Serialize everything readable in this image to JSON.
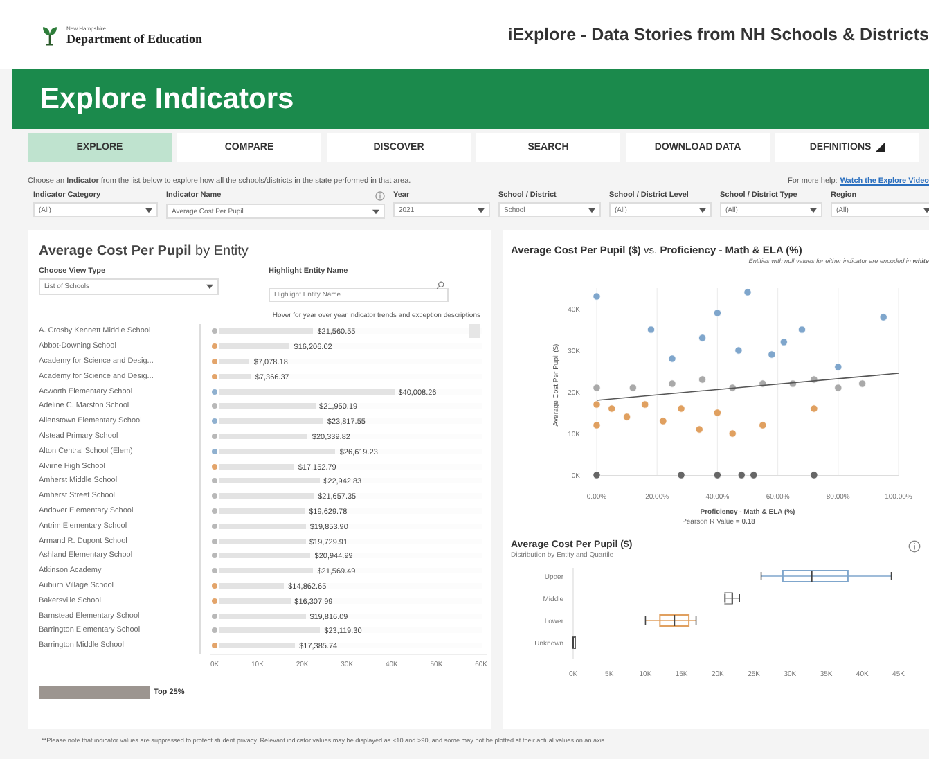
{
  "header": {
    "org_small": "New Hampshire",
    "org_name": "Department of Education",
    "site_title": "iExplore - Data Stories from NH Schools & Districts"
  },
  "banner": {
    "title": "Explore Indicators"
  },
  "tabs": [
    {
      "label": "EXPLORE",
      "selected": true
    },
    {
      "label": "COMPARE",
      "selected": false
    },
    {
      "label": "DISCOVER",
      "selected": false
    },
    {
      "label": "SEARCH",
      "selected": false
    },
    {
      "label": "DOWNLOAD DATA",
      "selected": false
    },
    {
      "label": "DEFINITIONS",
      "selected": false,
      "kind": "menu"
    }
  ],
  "instructions": {
    "text": "Choose an **Indicator** from the list below to explore how all the schools/districts in the state performed in that area.",
    "help_label": "For more help:",
    "help_link": "Watch the Explore Video"
  },
  "filters": [
    {
      "label": "Indicator Category",
      "value": "(All)"
    },
    {
      "label": "Indicator Name",
      "value": "Average Cost Per Pupil",
      "info": true
    },
    {
      "label": "Year",
      "value": "2021"
    },
    {
      "label": "School / District",
      "value": "School"
    },
    {
      "label": "School / District Level",
      "value": "(All)"
    },
    {
      "label": "School / District Type",
      "value": "(All)"
    },
    {
      "label": "Region",
      "value": "(All)"
    }
  ],
  "entity_panel": {
    "title": "**Average Cost Per Pupil** by Entity",
    "view_type_label": "Choose View Type",
    "view_type_value": "List of Schools",
    "highlight_label": "Highlight Entity Name",
    "highlight_placeholder": "Highlight Entity Name",
    "hint": "Hover for year over year indicator trends and exception descriptions",
    "entities": [
      {
        "name": "A. Crosby Kennett Middle School",
        "value": "$21,560.55",
        "level": 0.359,
        "color": "#b8b8b8"
      },
      {
        "name": "Abbot-Downing School",
        "value": "$16,206.02",
        "level": 0.27,
        "color": "#e3a46a"
      },
      {
        "name": "Academy for Science and Desig...",
        "value": "$7,078.18",
        "level": 0.118,
        "color": "#e3a46a"
      },
      {
        "name": "Academy for Science and Desig...",
        "value": "$7,366.37",
        "level": 0.123,
        "color": "#e3a46a"
      },
      {
        "name": "Acworth Elementary School",
        "value": "$40,008.26",
        "level": 0.667,
        "color": "#8fb0cf"
      },
      {
        "name": "Adeline C. Marston School",
        "value": "$21,950.19",
        "level": 0.366,
        "color": "#b8b8b8"
      },
      {
        "name": "Allenstown Elementary School",
        "value": "$23,817.55",
        "level": 0.397,
        "color": "#8fb0cf"
      },
      {
        "name": "Alstead Primary School",
        "value": "$20,339.82",
        "level": 0.339,
        "color": "#b8b8b8"
      },
      {
        "name": "Alton Central School (Elem)",
        "value": "$26,619.23",
        "level": 0.444,
        "color": "#8fb0cf"
      },
      {
        "name": "Alvirne High School",
        "value": "$17,152.79",
        "level": 0.286,
        "color": "#e3a46a"
      },
      {
        "name": "Amherst Middle School",
        "value": "$22,942.83",
        "level": 0.382,
        "color": "#b8b8b8"
      },
      {
        "name": "Amherst Street School",
        "value": "$21,657.35",
        "level": 0.361,
        "color": "#b8b8b8"
      },
      {
        "name": "Andover Elementary School",
        "value": "$19,629.78",
        "level": 0.327,
        "color": "#b8b8b8"
      },
      {
        "name": "Antrim Elementary School",
        "value": "$19,853.90",
        "level": 0.331,
        "color": "#b8b8b8"
      },
      {
        "name": "Armand R. Dupont School",
        "value": "$19,729.91",
        "level": 0.329,
        "color": "#b8b8b8"
      },
      {
        "name": "Ashland Elementary School",
        "value": "$20,944.99",
        "level": 0.349,
        "color": "#b8b8b8"
      },
      {
        "name": "Atkinson Academy",
        "value": "$21,569.49",
        "level": 0.359,
        "color": "#b8b8b8"
      },
      {
        "name": "Auburn Village School",
        "value": "$14,862.65",
        "level": 0.248,
        "color": "#e3a46a"
      },
      {
        "name": "Bakersville School",
        "value": "$16,307.99",
        "level": 0.272,
        "color": "#e3a46a"
      },
      {
        "name": "Barnstead Elementary School",
        "value": "$19,816.09",
        "level": 0.33,
        "color": "#b8b8b8"
      },
      {
        "name": "Barrington Elementary School",
        "value": "$23,119.30",
        "level": 0.385,
        "color": "#b8b8b8"
      },
      {
        "name": "Barrington Middle School",
        "value": "$17,385.74",
        "level": 0.29,
        "color": "#e3a46a"
      }
    ],
    "axis_ticks": [
      "0K",
      "10K",
      "20K",
      "30K",
      "40K",
      "50K",
      "60K"
    ],
    "legend": {
      "label": "Top 25%"
    }
  },
  "scatter_panel": {
    "title": "**Average Cost Per Pupil ($)** vs. **Proficiency - Math & ELA (%)**",
    "subtitle": "Entities with null values for either indicator are encoded in **white**",
    "pearson": "Pearson R Value = **0.18**",
    "chart_data": {
      "type": "scatter",
      "xlabel": "Proficiency - Math & ELA (%)",
      "ylabel": "Average Cost Per Pupil ($)",
      "xlim": [
        0,
        100
      ],
      "ylim": [
        0,
        45
      ],
      "xticks": [
        {
          "value": 0,
          "label": "0.00%"
        },
        {
          "value": 20,
          "label": "20.00%"
        },
        {
          "value": 40,
          "label": "40.00%"
        },
        {
          "value": 60,
          "label": "60.00%"
        },
        {
          "value": 80,
          "label": "80.00%"
        },
        {
          "value": 100,
          "label": "100.00%"
        }
      ],
      "yticks": [
        {
          "value": 0,
          "label": "0K"
        },
        {
          "value": 10,
          "label": "10K"
        },
        {
          "value": 20,
          "label": "20K"
        },
        {
          "value": 30,
          "label": "30K"
        },
        {
          "value": 40,
          "label": "40K"
        }
      ],
      "grid": true,
      "x": [
        0,
        18,
        25,
        35,
        40,
        47,
        50,
        58,
        62,
        68,
        80,
        95,
        0,
        12,
        25,
        35,
        45,
        55,
        65,
        72,
        80,
        88,
        0,
        0,
        5,
        10,
        16,
        22,
        28,
        34,
        40,
        45,
        55,
        72,
        0,
        28,
        40,
        48,
        52,
        72,
        0,
        100
      ],
      "series": [
        {
          "color": "#7fa6cc",
          "values": [
            43,
            35,
            28,
            33,
            39,
            30,
            44,
            29,
            32,
            35,
            26,
            38,
            null,
            null,
            null,
            null,
            null,
            null,
            null,
            null,
            null,
            null,
            null,
            null,
            null,
            null,
            null,
            null,
            null,
            null,
            null,
            null,
            null,
            null,
            null,
            null,
            null,
            null,
            null,
            null,
            null,
            null
          ]
        },
        {
          "color": "#a9a9a9",
          "values": [
            null,
            null,
            null,
            null,
            null,
            null,
            null,
            null,
            null,
            null,
            null,
            null,
            21,
            21,
            22,
            23,
            21,
            22,
            22,
            23,
            21,
            22,
            null,
            null,
            null,
            null,
            null,
            null,
            null,
            null,
            null,
            null,
            null,
            null,
            null,
            null,
            null,
            null,
            null,
            null,
            null,
            null
          ]
        },
        {
          "color": "#e0a060",
          "values": [
            null,
            null,
            null,
            null,
            null,
            null,
            null,
            null,
            null,
            null,
            null,
            null,
            null,
            null,
            null,
            null,
            null,
            null,
            null,
            null,
            null,
            null,
            17,
            12,
            16,
            14,
            17,
            13,
            16,
            11,
            15,
            10,
            12,
            16,
            null,
            null,
            null,
            null,
            null,
            null,
            null,
            null
          ]
        },
        {
          "color": "#666666",
          "values": [
            null,
            null,
            null,
            null,
            null,
            null,
            null,
            null,
            null,
            null,
            null,
            null,
            null,
            null,
            null,
            null,
            null,
            null,
            null,
            null,
            null,
            null,
            null,
            null,
            null,
            null,
            null,
            null,
            null,
            null,
            null,
            null,
            null,
            null,
            0,
            0,
            0,
            0,
            0,
            0,
            null,
            null
          ]
        },
        {
          "type": "line",
          "color": "#555555",
          "values": [
            null,
            null,
            null,
            null,
            null,
            null,
            null,
            null,
            null,
            null,
            null,
            null,
            null,
            null,
            null,
            null,
            null,
            null,
            null,
            null,
            null,
            null,
            null,
            null,
            null,
            null,
            null,
            null,
            null,
            null,
            null,
            null,
            null,
            null,
            null,
            null,
            null,
            null,
            null,
            null,
            18,
            24.5
          ]
        }
      ]
    }
  },
  "box_panel": {
    "title": "Average Cost Per Pupil ($)",
    "subtitle": "Distribution by Entity and Quartile",
    "categories": [
      "Upper",
      "Middle",
      "Lower",
      "Unknown"
    ],
    "xticks": [
      "0K",
      "5K",
      "10K",
      "15K",
      "20K",
      "25K",
      "30K",
      "35K",
      "40K",
      "45K"
    ]
  },
  "footnote": "**Please note that indicator values are suppressed to protect student privacy. Relevant indicator values may be displayed as <10 and >90, and some may not be plotted at their actual values on an axis."
}
